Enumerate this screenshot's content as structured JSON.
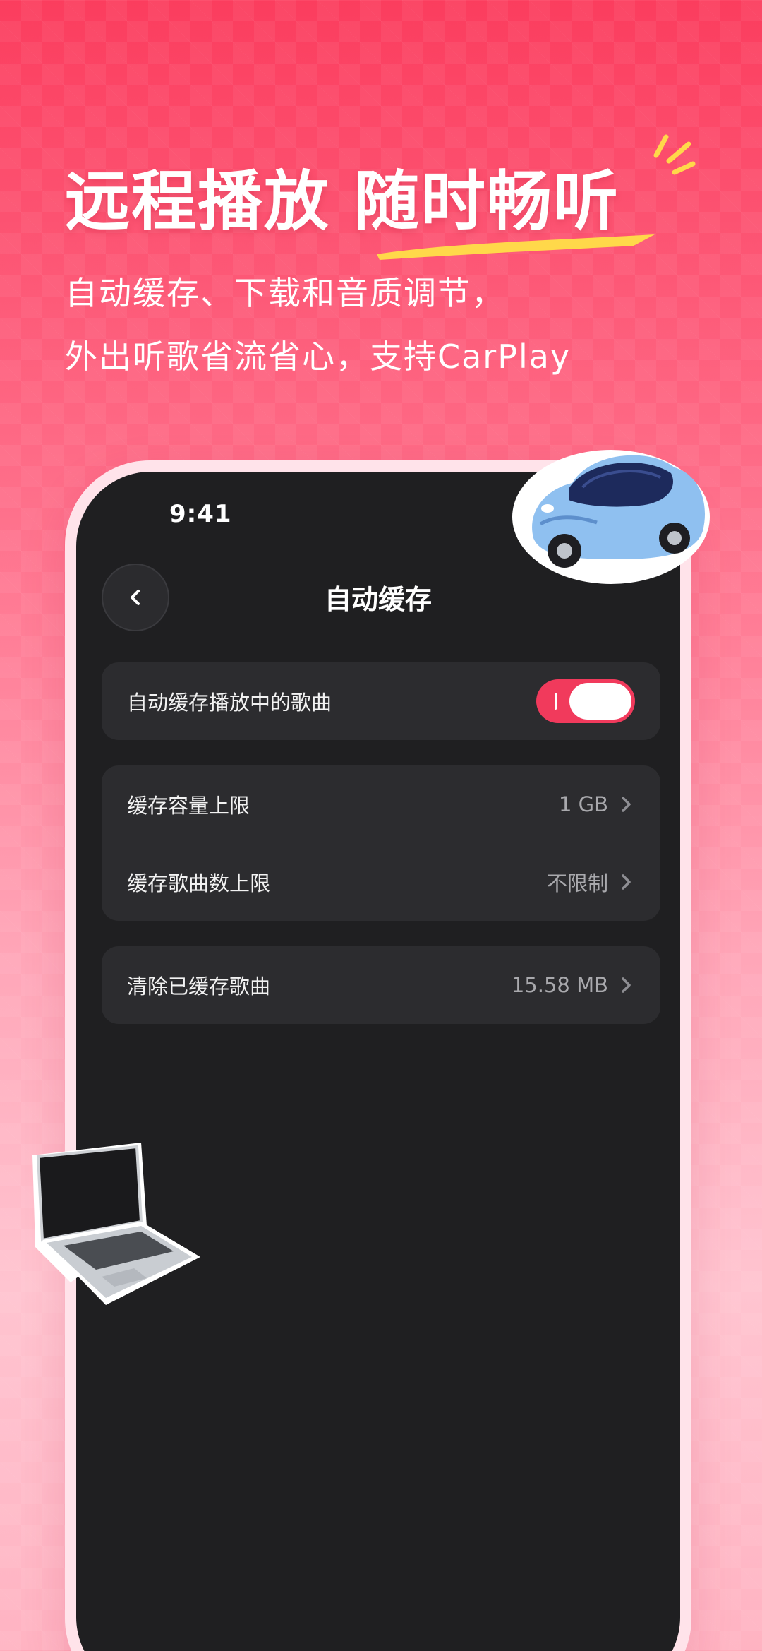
{
  "promo": {
    "headline_part1": "远程播放",
    "headline_part2": "随时畅听",
    "subtitle_line1": "自动缓存、下载和音质调节，",
    "subtitle_line2": "外出听歌省流省心，支持CarPlay"
  },
  "status_bar": {
    "time": "9:41"
  },
  "nav": {
    "title": "自动缓存"
  },
  "settings": {
    "auto_cache": {
      "label": "自动缓存播放中的歌曲",
      "enabled": true
    },
    "cache_capacity": {
      "label": "缓存容量上限",
      "value": "1 GB"
    },
    "cache_song_count": {
      "label": "缓存歌曲数上限",
      "value": "不限制"
    },
    "clear_cache": {
      "label": "清除已缓存歌曲",
      "value": "15.58 MB"
    }
  },
  "colors": {
    "accent": "#f13a5c",
    "background_top": "#fb3d5e",
    "screen_bg": "#1f1f21",
    "card_bg": "#2c2c2f",
    "highlight_stroke": "#ffd84a"
  },
  "icons": {
    "back": "chevron-left-icon",
    "row_arrow": "chevron-right-icon",
    "decor_1": "sparkle-icon",
    "decor_2": "car-illustration",
    "decor_3": "laptop-illustration"
  }
}
